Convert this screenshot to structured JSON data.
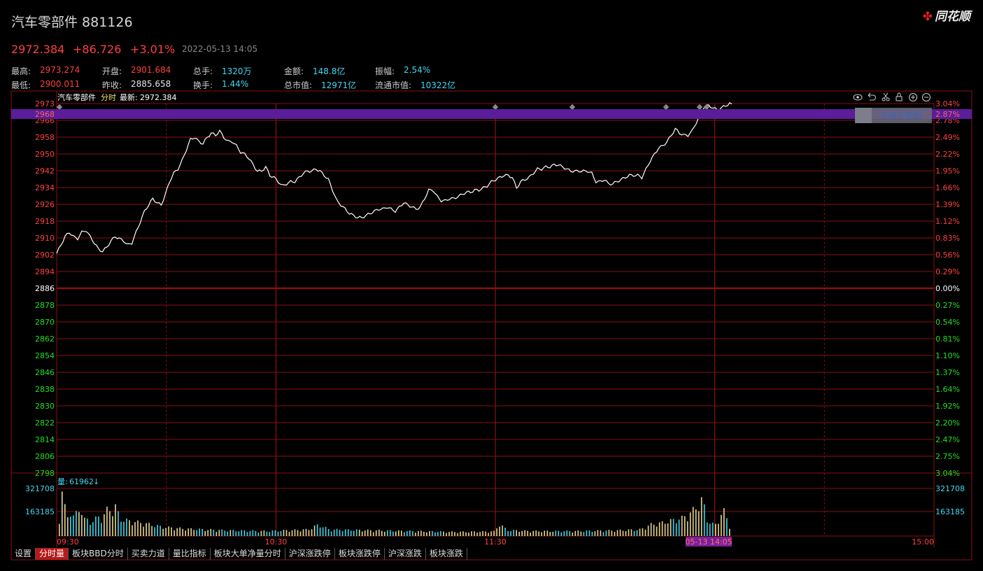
{
  "header": {
    "title": "汽车零部件 881126",
    "logo": "同花顺",
    "last_price": "2972.384",
    "change": "+86.726",
    "change_pct": "+3.01%",
    "datetime": "2022-05-13 14:05"
  },
  "stats": {
    "high_label": "最高:",
    "high": "2973.274",
    "open_label": "开盘:",
    "open": "2901.684",
    "volume_label": "总手:",
    "volume": "1320万",
    "amount_label": "金额:",
    "amount": "148.8亿",
    "amplitude_label": "振幅:",
    "amplitude": "2.54%",
    "low_label": "最低:",
    "low": "2900.011",
    "prev_close_label": "昨收:",
    "prev_close": "2885.658",
    "turnover_label": "换手:",
    "turnover": "1.44%",
    "total_cap_label": "总市值:",
    "total_cap": "12971亿",
    "float_cap_label": "流通市值:",
    "float_cap": "10322亿"
  },
  "chart_header": {
    "name": "汽车零部件",
    "mode": "分时",
    "latest_label": "最新:",
    "latest": "2972.384"
  },
  "generate_button": "生成走势图",
  "crosshair": {
    "price": "2968",
    "pct": "2.87%",
    "time": "05-13 14:05"
  },
  "toolbar_icons": [
    "eye-icon",
    "undo-icon",
    "scissors-icon",
    "lock-icon",
    "zoom-in-icon",
    "zoom-out-icon"
  ],
  "volume_header": {
    "label": "量:",
    "value": "61962",
    "arrow": "↓"
  },
  "tabs": [
    "设置",
    "分时量",
    "板块BBD分时",
    "买卖力道",
    "量比指标",
    "板块大单净量分时",
    "沪深涨跌停",
    "板块涨跌停",
    "沪深涨跌",
    "板块涨跌"
  ],
  "active_tab": 1,
  "colors": {
    "up": "#ff4040",
    "down": "#20e020",
    "grid": "#8a1010",
    "line": "#ffffff",
    "volume_up": "#e8d890",
    "volume_down": "#40d8f0",
    "crosshair": "#6a1fa0"
  },
  "chart_data": {
    "type": "line",
    "prev_close": 2885.658,
    "ylim": [
      2798,
      2973
    ],
    "y_ticks": [
      "2973",
      "2966",
      "2958",
      "2950",
      "2942",
      "2934",
      "2926",
      "2918",
      "2910",
      "2902",
      "2894",
      "2886",
      "2878",
      "2870",
      "2862",
      "2854",
      "2846",
      "2838",
      "2830",
      "2822",
      "2814",
      "2806",
      "2798"
    ],
    "pct_ticks": [
      "3.04%",
      "2.78%",
      "2.49%",
      "2.22%",
      "1.95%",
      "1.66%",
      "1.39%",
      "1.12%",
      "0.83%",
      "0.56%",
      "0.29%",
      "0.00%",
      "0.27%",
      "0.54%",
      "0.81%",
      "1.10%",
      "1.37%",
      "1.64%",
      "1.92%",
      "2.20%",
      "2.47%",
      "2.75%",
      "3.04%"
    ],
    "x_ticks": [
      "09:30",
      "10:30",
      "11:30",
      "15:00"
    ],
    "volume_ticks": [
      "321708",
      "163185"
    ],
    "volume_max": 321708,
    "price_key": [
      [
        0,
        2902
      ],
      [
        2,
        2906
      ],
      [
        4,
        2910
      ],
      [
        6,
        2912
      ],
      [
        8,
        2910
      ],
      [
        10,
        2909
      ],
      [
        12,
        2912
      ],
      [
        14,
        2913
      ],
      [
        16,
        2910
      ],
      [
        18,
        2907
      ],
      [
        20,
        2904
      ],
      [
        22,
        2903
      ],
      [
        24,
        2905
      ],
      [
        26,
        2908
      ],
      [
        28,
        2910
      ],
      [
        30,
        2909
      ],
      [
        32,
        2908
      ],
      [
        34,
        2906
      ],
      [
        36,
        2907
      ],
      [
        38,
        2912
      ],
      [
        40,
        2917
      ],
      [
        42,
        2922
      ],
      [
        44,
        2925
      ],
      [
        46,
        2928
      ],
      [
        48,
        2926
      ],
      [
        50,
        2925
      ],
      [
        52,
        2930
      ],
      [
        54,
        2936
      ],
      [
        56,
        2940
      ],
      [
        58,
        2942
      ],
      [
        60,
        2946
      ],
      [
        62,
        2951
      ],
      [
        64,
        2956
      ],
      [
        66,
        2957
      ],
      [
        68,
        2955
      ],
      [
        70,
        2954
      ],
      [
        72,
        2957
      ],
      [
        74,
        2959
      ],
      [
        76,
        2958
      ],
      [
        78,
        2960
      ],
      [
        80,
        2957
      ],
      [
        82,
        2955
      ],
      [
        84,
        2955
      ],
      [
        86,
        2953
      ],
      [
        88,
        2950
      ],
      [
        90,
        2949
      ],
      [
        92,
        2947
      ],
      [
        94,
        2944
      ],
      [
        96,
        2941
      ],
      [
        98,
        2941
      ],
      [
        100,
        2943
      ],
      [
        102,
        2939
      ],
      [
        104,
        2938
      ],
      [
        106,
        2936
      ],
      [
        108,
        2934
      ],
      [
        110,
        2935
      ],
      [
        112,
        2936
      ],
      [
        114,
        2936
      ],
      [
        116,
        2938
      ],
      [
        118,
        2940
      ],
      [
        120,
        2941
      ],
      [
        122,
        2941
      ],
      [
        124,
        2942
      ],
      [
        126,
        2941
      ],
      [
        128,
        2939
      ],
      [
        130,
        2937
      ],
      [
        132,
        2932
      ],
      [
        134,
        2927
      ],
      [
        136,
        2925
      ],
      [
        138,
        2923
      ],
      [
        140,
        2921
      ],
      [
        142,
        2920
      ],
      [
        144,
        2919
      ],
      [
        146,
        2919
      ],
      [
        148,
        2920
      ],
      [
        150,
        2921
      ],
      [
        152,
        2922
      ],
      [
        154,
        2923
      ],
      [
        156,
        2923
      ],
      [
        158,
        2924
      ],
      [
        160,
        2923
      ],
      [
        162,
        2922
      ],
      [
        164,
        2924
      ],
      [
        166,
        2926
      ],
      [
        168,
        2925
      ],
      [
        170,
        2924
      ],
      [
        172,
        2923
      ],
      [
        174,
        2924
      ],
      [
        176,
        2928
      ],
      [
        178,
        2932
      ],
      [
        180,
        2932
      ],
      [
        182,
        2929
      ],
      [
        184,
        2927
      ],
      [
        186,
        2927
      ],
      [
        188,
        2928
      ],
      [
        190,
        2928
      ],
      [
        192,
        2929
      ],
      [
        194,
        2930
      ],
      [
        196,
        2931
      ],
      [
        198,
        2931
      ],
      [
        200,
        2932
      ],
      [
        202,
        2932
      ],
      [
        204,
        2933
      ],
      [
        206,
        2934
      ],
      [
        208,
        2936
      ],
      [
        210,
        2937
      ],
      [
        212,
        2938
      ],
      [
        214,
        2939
      ],
      [
        216,
        2939
      ],
      [
        218,
        2938
      ],
      [
        220,
        2933
      ],
      [
        222,
        2936
      ],
      [
        224,
        2937
      ],
      [
        226,
        2938
      ],
      [
        228,
        2940
      ],
      [
        230,
        2942
      ],
      [
        232,
        2942
      ],
      [
        234,
        2943
      ],
      [
        236,
        2943
      ],
      [
        238,
        2944
      ],
      [
        240,
        2944
      ],
      [
        242,
        2943
      ],
      [
        244,
        2942
      ],
      [
        246,
        2941
      ],
      [
        248,
        2941
      ],
      [
        250,
        2941
      ],
      [
        252,
        2941
      ],
      [
        254,
        2941
      ],
      [
        256,
        2940
      ],
      [
        258,
        2936
      ],
      [
        260,
        2936
      ],
      [
        262,
        2937
      ],
      [
        264,
        2935
      ],
      [
        266,
        2935
      ],
      [
        268,
        2936
      ],
      [
        270,
        2937
      ],
      [
        272,
        2938
      ],
      [
        274,
        2939
      ],
      [
        276,
        2939
      ],
      [
        278,
        2939
      ],
      [
        280,
        2938
      ],
      [
        282,
        2942
      ],
      [
        284,
        2946
      ],
      [
        286,
        2949
      ],
      [
        288,
        2952
      ],
      [
        290,
        2953
      ],
      [
        292,
        2955
      ],
      [
        294,
        2958
      ],
      [
        296,
        2961
      ],
      [
        298,
        2959
      ],
      [
        300,
        2958
      ],
      [
        302,
        2958
      ],
      [
        304,
        2960
      ],
      [
        306,
        2964
      ],
      [
        308,
        2968
      ],
      [
        310,
        2972
      ],
      [
        312,
        2972
      ],
      [
        314,
        2971
      ],
      [
        316,
        2970
      ],
      [
        318,
        2971
      ],
      [
        320,
        2972
      ],
      [
        322,
        2973
      ],
      [
        323,
        2972.384
      ]
    ],
    "volume_key": [
      [
        0,
        110000
      ],
      [
        1,
        315000
      ],
      [
        2,
        180000
      ],
      [
        3,
        170000
      ],
      [
        4,
        120000
      ],
      [
        5,
        160000
      ],
      [
        6,
        140000
      ],
      [
        7,
        110000
      ],
      [
        8,
        135000
      ],
      [
        9,
        170000
      ],
      [
        10,
        175000
      ],
      [
        11,
        140000
      ],
      [
        12,
        100000
      ],
      [
        13,
        105000
      ],
      [
        14,
        95000
      ],
      [
        15,
        90000
      ],
      [
        16,
        85000
      ],
      [
        17,
        100000
      ],
      [
        18,
        110000
      ],
      [
        19,
        120000
      ],
      [
        20,
        115000
      ],
      [
        21,
        110000
      ],
      [
        22,
        140000
      ],
      [
        23,
        160000
      ],
      [
        24,
        175000
      ],
      [
        25,
        145000
      ],
      [
        26,
        155000
      ],
      [
        27,
        180000
      ],
      [
        28,
        150000
      ],
      [
        29,
        120000
      ],
      [
        30,
        100000
      ],
      [
        40,
        80000
      ],
      [
        50,
        55000
      ],
      [
        60,
        45000
      ],
      [
        70,
        40000
      ],
      [
        80,
        35000
      ],
      [
        100,
        30000
      ],
      [
        120,
        40000
      ],
      [
        125,
        70000
      ],
      [
        130,
        40000
      ],
      [
        150,
        35000
      ],
      [
        170,
        30000
      ],
      [
        190,
        25000
      ],
      [
        210,
        28000
      ],
      [
        212,
        78000
      ],
      [
        214,
        55000
      ],
      [
        216,
        35000
      ],
      [
        230,
        30000
      ],
      [
        250,
        30000
      ],
      [
        270,
        35000
      ],
      [
        280,
        40000
      ],
      [
        285,
        70000
      ],
      [
        290,
        80000
      ],
      [
        295,
        95000
      ],
      [
        300,
        110000
      ],
      [
        304,
        140000
      ],
      [
        308,
        190000
      ],
      [
        310,
        230000
      ],
      [
        312,
        100000
      ],
      [
        314,
        80000
      ],
      [
        316,
        65000
      ],
      [
        318,
        110000
      ],
      [
        320,
        160000
      ],
      [
        322,
        100000
      ],
      [
        323,
        62000
      ]
    ]
  }
}
